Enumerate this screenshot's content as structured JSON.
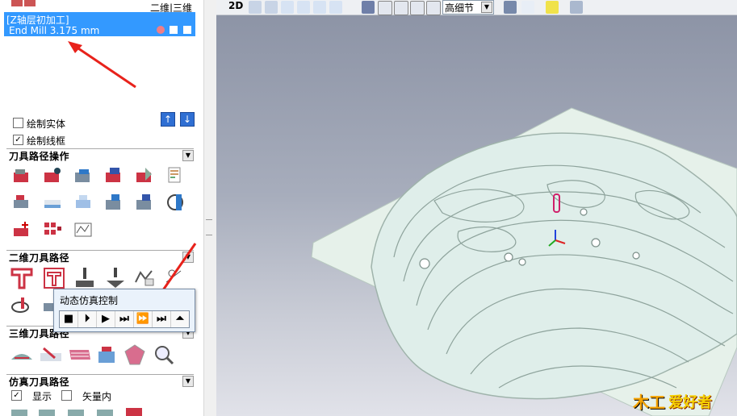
{
  "left_panel": {
    "header_tab_2d3d": "二维|三维",
    "toolpath_item": {
      "title": "[Z轴层初加工]",
      "tool": "End Mill 3.175 mm"
    },
    "draw_solid": {
      "label": "绘制实体",
      "checked": false
    },
    "draw_wireframe": {
      "label": "绘制线框",
      "checked": true
    },
    "sections": {
      "toolpath_ops": "刀具路径操作",
      "twod_toolpaths": "二维刀具路径",
      "threed_toolpaths": "三维刀具路径",
      "sim_toolpaths": "仿真刀具路径"
    },
    "sim_show": {
      "label": "显示",
      "checked": true
    },
    "sim_vector": {
      "label": "矢量内",
      "checked": false
    }
  },
  "sim_popup": {
    "title": "动态仿真控制",
    "buttons": [
      "■",
      "⏵",
      "▶",
      "⏭",
      "⏩",
      "⏭",
      "⏶"
    ]
  },
  "toolbar": {
    "view_2d": "2D",
    "detail_select": "高细节"
  },
  "watermark": {
    "text": "爱好者",
    "prefix": "木工"
  },
  "icons": {
    "colors": {
      "accent": "#3399ff",
      "red_arrow": "#e8221b",
      "panel_bg": "#ffffff"
    }
  }
}
